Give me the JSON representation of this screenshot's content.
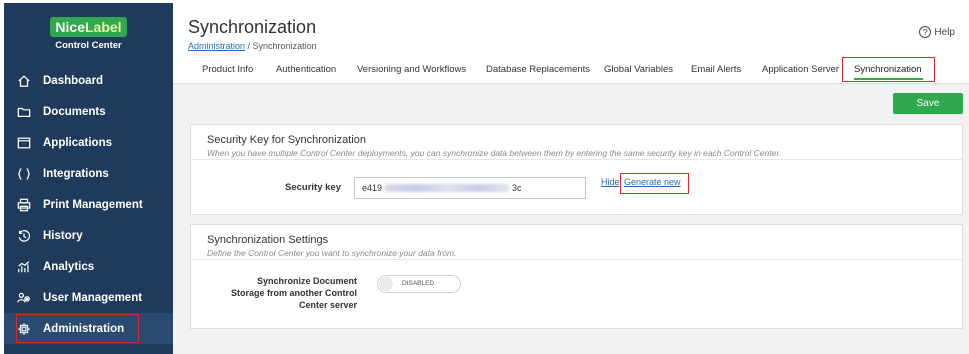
{
  "brand": {
    "logo_nice": "Nice",
    "logo_label": "Label",
    "subtitle": "Control Center",
    "green": "#2fa84f",
    "navy": "#1f3a5b"
  },
  "sidebar": {
    "items": [
      {
        "label": "Dashboard",
        "icon": "home-icon"
      },
      {
        "label": "Documents",
        "icon": "folder-icon"
      },
      {
        "label": "Applications",
        "icon": "window-icon"
      },
      {
        "label": "Integrations",
        "icon": "braces-icon"
      },
      {
        "label": "Print Management",
        "icon": "printer-icon"
      },
      {
        "label": "History",
        "icon": "history-icon"
      },
      {
        "label": "Analytics",
        "icon": "analytics-icon"
      },
      {
        "label": "User Management",
        "icon": "users-icon"
      },
      {
        "label": "Administration",
        "icon": "gear-icon",
        "active": true
      }
    ]
  },
  "header": {
    "title": "Synchronization",
    "breadcrumb_link": "Administration",
    "breadcrumb_sep": " / ",
    "breadcrumb_current": "Synchronization",
    "help": "Help"
  },
  "tabs": [
    "Product Info",
    "Authentication",
    "Versioning and Workflows",
    "Database Replacements",
    "Global Variables",
    "Email Alerts",
    "Application Server",
    "Synchronization"
  ],
  "active_tab": "Synchronization",
  "toolbar": {
    "save_label": "Save"
  },
  "security_card": {
    "title": "Security Key for Synchronization",
    "description": "When you have multiple Control Center deployments, you can synchronize data between them by entering the same security key in each Control Center.",
    "key_label": "Security key",
    "key_prefix": "e419",
    "key_suffix": "3c",
    "hide_link": "Hide",
    "generate_link": "Generate new"
  },
  "settings_card": {
    "title": "Synchronization Settings",
    "description": "Define the Control Center you want to synchronize your data from.",
    "sync_label": "Synchronize Document Storage from another Control Center server",
    "toggle_state": "DISABLED"
  }
}
